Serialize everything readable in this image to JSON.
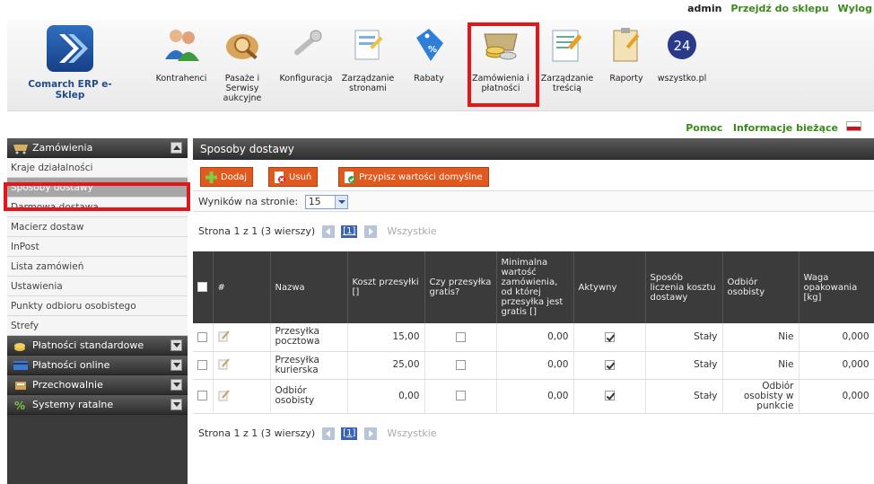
{
  "header": {
    "user": "admin",
    "shop_link": "Przejdź do sklepu",
    "logout_link": "Wylog",
    "brand_label": "Comarch ERP e-Sklep"
  },
  "nav": {
    "kontrahenci": "Kontrahenci",
    "pasaze_1": "Pasaże i Serwisy",
    "pasaze_2": "aukcyjne",
    "konfiguracja": "Konfiguracja",
    "zarzadzanie_1": "Zarządzanie",
    "zarzadzanie_2": "stronami",
    "rabaty": "Rabaty",
    "zamowienia_1": "Zamówienia i",
    "zamowienia_2": "płatności",
    "tresc_1": "Zarządzanie",
    "tresc_2": "treścią",
    "raporty": "Raporty",
    "wszystko": "wszystko.pl",
    "badge_24": "24"
  },
  "info": {
    "pomoc": "Pomoc",
    "biezace": "Informacje bieżące"
  },
  "sidebar": {
    "section_zamowienia": "Zamówienia",
    "items": [
      "Kraje działalności",
      "Sposoby dostawy",
      "Darmowa dostawa",
      "Macierz dostaw",
      "InPost",
      "Lista zamówień",
      "Ustawienia",
      "Punkty odbioru osobistego",
      "Strefy"
    ],
    "section_platnosci_std": "Płatności standardowe",
    "section_platnosci_online": "Płatności online",
    "section_przechowalnie": "Przechowalnie",
    "section_systemy": "Systemy ratalne"
  },
  "main": {
    "title": "Sposoby dostawy",
    "toolbar": {
      "add": "Dodaj",
      "delete": "Usuń",
      "defaults": "Przypisz wartości domyślne"
    },
    "per_page_label": "Wyników na stronie:",
    "per_page_value": "15",
    "pager": {
      "text": "Strona 1 z 1 (3 wierszy)",
      "page": "[1]",
      "all": "Wszystkie"
    },
    "columns": {
      "hash": "#",
      "name": "Nazwa",
      "cost": "Koszt przesyłki []",
      "free": "Czy przesyłka gratis?",
      "min_value": "Minimalna wartość zamówienia, od której przesyłka jest gratis []",
      "active": "Aktywny",
      "calc": "Sposób liczenia kosztu dostawy",
      "pickup": "Odbiór osobisty",
      "weight": "Waga opakowania [kg]"
    },
    "rows": [
      {
        "name": "Przesyłka pocztowa",
        "cost": "15,00",
        "min_value": "0,00",
        "active": true,
        "calc": "Stały",
        "pickup": "Nie",
        "weight": "0,000"
      },
      {
        "name": "Przesyłka kurierska",
        "cost": "25,00",
        "min_value": "0,00",
        "active": true,
        "calc": "Stały",
        "pickup": "Nie",
        "weight": "0,000"
      },
      {
        "name": "Odbiór osobisty",
        "cost": "0,00",
        "min_value": "0,00",
        "active": true,
        "calc": "Stały",
        "pickup": "Odbiór osobisty w punkcie",
        "weight": "0,000"
      }
    ]
  },
  "colors": {
    "highlight": "#e3161a",
    "toolbar_button": "#e05a20",
    "link_green": "#3a8a1a",
    "dark_header": "#3b3b3b"
  }
}
